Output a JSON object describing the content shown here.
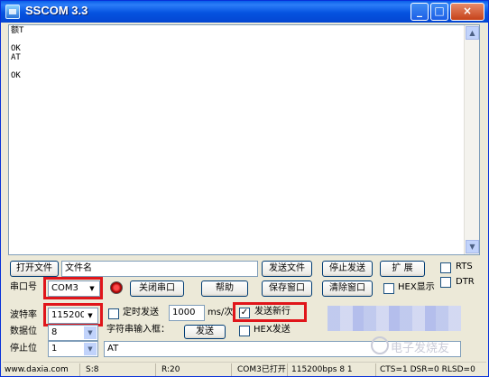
{
  "window": {
    "title": "SSCOM 3.3",
    "minimize": "_",
    "maximize": "□",
    "close": "×"
  },
  "receive": {
    "text": "额T\n\nOK\nAT\n\nOK"
  },
  "toolbar_row1": {
    "open_file": "打开文件",
    "file_name": "文件名",
    "send_file": "发送文件",
    "stop_send": "停止发送",
    "expand": "扩 展",
    "rts": "RTS",
    "dtr": "DTR"
  },
  "toolbar_row2": {
    "port_label": "串口号",
    "port_value": "COM3",
    "close_port": "关闭串口",
    "help": "帮助",
    "save_window": "保存窗口",
    "clear_window": "清除窗口",
    "hex_display": "HEX显示"
  },
  "toolbar_row3": {
    "baud_label": "波特率",
    "baud_value": "115200",
    "timed_send": "定时发送",
    "interval": "1000",
    "interval_unit": "ms/次",
    "send_newline": "发送新行",
    "send_newline_checked": "✓"
  },
  "toolbar_row4": {
    "data_bits_label": "数据位",
    "data_bits_value": "8",
    "string_input": "字符串输入框：",
    "send_button": "发送",
    "hex_send": "HEX发送"
  },
  "toolbar_row5": {
    "stop_bits_label": "停止位",
    "stop_bits_value": "1",
    "send_text": "AT"
  },
  "status": {
    "site": "www.daxia.com",
    "sent": "S:8",
    "received": "R:20",
    "port_state": "COM3已打开",
    "settings": "115200bps  8  1",
    "signals": "CTS=1 DSR=0 RLSD=0"
  },
  "watermark": "电子发烧友"
}
